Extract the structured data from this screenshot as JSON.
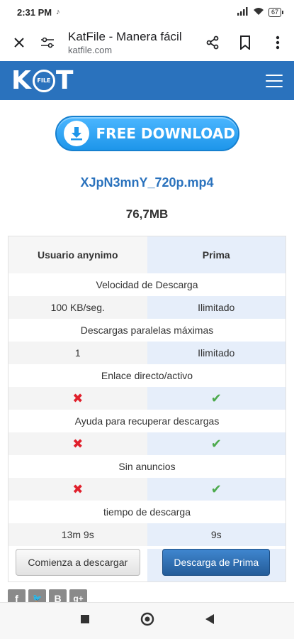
{
  "status_bar": {
    "time": "2:31 PM",
    "battery": "67"
  },
  "browser": {
    "title": "KatFile - Manera fácil",
    "url": "katfile.com"
  },
  "site": {
    "logo_left": "K",
    "logo_circle": "FILE",
    "logo_right": "T"
  },
  "download_button": {
    "label": "FREE DOWNLOAD"
  },
  "file": {
    "name": "XJpN3mnY_720p.mp4",
    "size": "76,7MB"
  },
  "table": {
    "header": {
      "free": "Usuario anynimo",
      "premium": "Prima"
    },
    "features": [
      {
        "label": "Velocidad de Descarga",
        "free": "100 KB/seg.",
        "premium": "Ilimitado"
      },
      {
        "label": "Descargas paralelas máximas",
        "free": "1",
        "premium": "Ilimitado"
      },
      {
        "label": "Enlace directo/activo",
        "free": "✖",
        "premium": "✔"
      },
      {
        "label": "Ayuda para recuperar descargas",
        "free": "✖",
        "premium": "✔"
      },
      {
        "label": "Sin anuncios",
        "free": "✖",
        "premium": "✔"
      },
      {
        "label": "tiempo de descarga",
        "free": "13m 9s",
        "premium": "9s"
      }
    ],
    "buttons": {
      "free": "Comienza a descargar",
      "premium": "Descarga de Prima"
    }
  },
  "social": {
    "facebook": "f",
    "twitter": "🐦",
    "blogger": "B",
    "gplus": "g+"
  },
  "colors": {
    "brand": "#2a72bd",
    "premium_bg": "#e6eefa",
    "cross": "#e0202c",
    "check": "#4caa4c"
  }
}
